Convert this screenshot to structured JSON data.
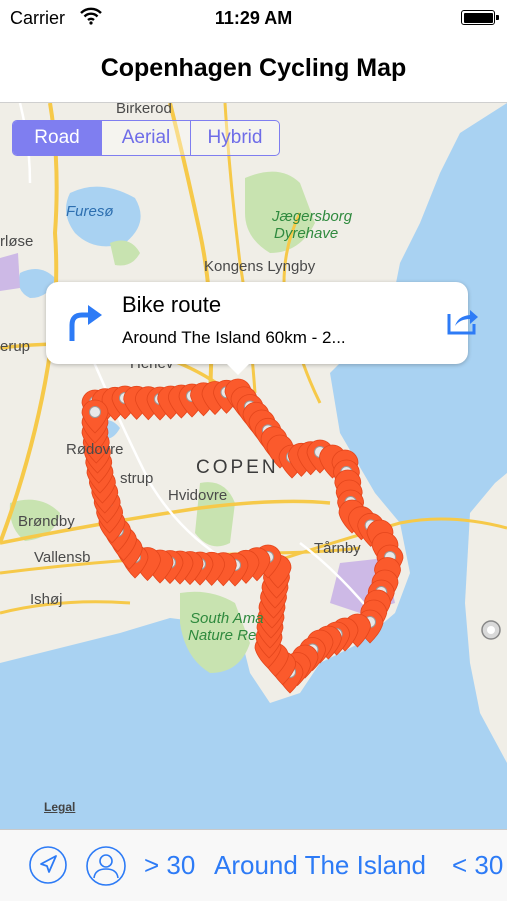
{
  "status_bar": {
    "carrier": "Carrier",
    "time": "11:29 AM"
  },
  "nav": {
    "title": "Copenhagen Cycling Map"
  },
  "map_type": {
    "options": [
      "Road",
      "Aerial",
      "Hybrid"
    ],
    "selected": "Road"
  },
  "map_labels": {
    "birkerod": "Birkerod",
    "fureso": "Furesø",
    "jaegersborg": "Jægersborg",
    "dyrehave": "Dyrehave",
    "kongens_lyngby": "Kongens Lyngby",
    "erlose": "rløse",
    "erup": "erup",
    "herlev": "Herlev",
    "rodovre": "Rødovre",
    "copenhagen": "COPEN",
    "strup": "strup",
    "hvidovre": "Hvidovre",
    "brondby": "Brøndby",
    "vallensbaek": "Vallensb",
    "ishoj": "Ishøj",
    "tarnby": "Tårnby",
    "south_amager_1": "South Ama",
    "south_amager_2": "Nature Re",
    "legal": "Legal"
  },
  "callout": {
    "title": "Bike route",
    "subtitle": "Around The Island 60km - 2..."
  },
  "toolbar": {
    "filter_over": "> 30",
    "route_name": "Around The Island",
    "filter_under": "< 30"
  },
  "colors": {
    "pin": "#fb5a2c",
    "accent": "#2d7bf6",
    "segment": "#7f7ef0",
    "water": "#a9d2f2",
    "land": "#f0eee7",
    "park": "#c8e3b0"
  }
}
